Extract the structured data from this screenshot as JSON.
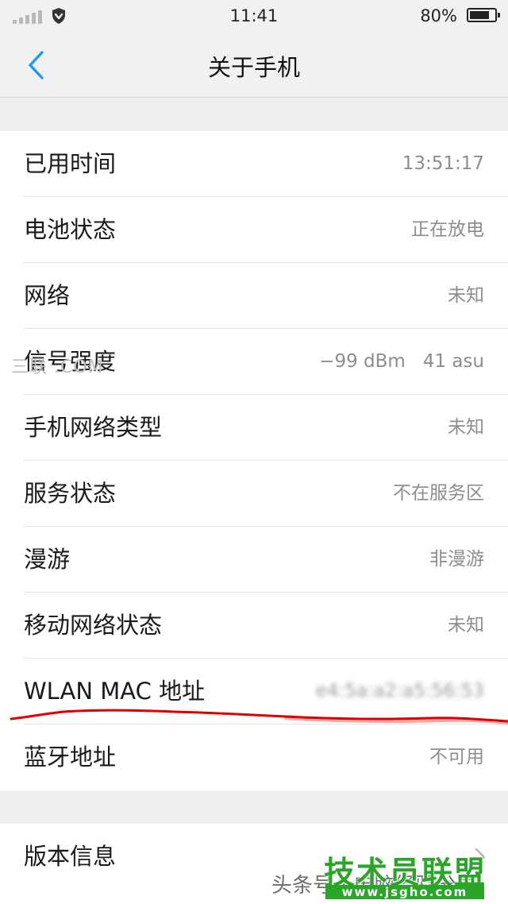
{
  "status_bar": {
    "time": "11:41",
    "battery_percent": "80%",
    "battery_level": 0.8
  },
  "nav": {
    "back_icon": "chevron-left-icon",
    "title": "关于手机"
  },
  "group1": {
    "rows": [
      {
        "label": "已用时间",
        "value": "13:51:17"
      },
      {
        "label": "电池状态",
        "value": "正在放电"
      },
      {
        "label": "网络",
        "value": "未知"
      },
      {
        "label": "信号强度",
        "value": "−99 dBm   41 asu"
      },
      {
        "label": "手机网络类型",
        "value": "未知"
      },
      {
        "label": "服务状态",
        "value": "不在服务区"
      },
      {
        "label": "漫游",
        "value": "非漫游"
      },
      {
        "label": "移动网络状态",
        "value": "未知"
      },
      {
        "label": "WLAN MAC 地址",
        "value": "e4:5a:a2:a5:56:53"
      },
      {
        "label": "蓝牙地址",
        "value": "不可用"
      }
    ]
  },
  "group2": {
    "rows": [
      {
        "label": "版本信息",
        "icon": "chevron-right-icon"
      }
    ]
  },
  "watermarks": {
    "left": "三联  .COM",
    "bottom": "头条号 / 电脑经验分享",
    "logo_main": "技术员联盟",
    "logo_sub": "www.jsgho.com"
  },
  "colors": {
    "accent": "#1a9cf0",
    "annotation": "#e00000",
    "logo_green": "#2aa52a"
  }
}
